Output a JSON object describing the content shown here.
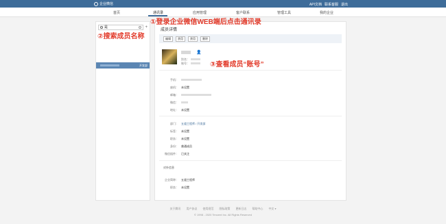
{
  "topbar": {
    "app_name": "企业微信",
    "links": [
      "API文档",
      "联系客服",
      "退出"
    ]
  },
  "nav": {
    "tabs": [
      "首页",
      "通讯录",
      "应用管理",
      "客户联系",
      "管理工具",
      "我的企业"
    ],
    "active": "通讯录"
  },
  "left": {
    "search_value": "是",
    "add_label": "+",
    "result_dept": "开发部"
  },
  "detail": {
    "title": "成员详情",
    "buttons": [
      "编辑",
      "禁用",
      "禁用",
      "删除"
    ],
    "alias_label": "别名：",
    "account_label": "账号：",
    "fields": [
      {
        "label": "手机：",
        "value": ""
      },
      {
        "label": "座机：",
        "value": "未设置"
      },
      {
        "label": "邮箱：",
        "value": ""
      },
      {
        "label": "微信：",
        "value": ""
      },
      {
        "label": "地址：",
        "value": "未设置"
      }
    ],
    "dept_label": "部门：",
    "dept_value": "五道工程师 / 开发部",
    "org_fields": [
      {
        "label": "标签：",
        "value": "未设置"
      },
      {
        "label": "职务：",
        "value": "未设置"
      },
      {
        "label": "身份：",
        "value": "普通成员"
      },
      {
        "label": "微信插件：",
        "value": "已关注"
      }
    ],
    "external_title": "对外信息",
    "external_fields": [
      {
        "label": "企业简称：",
        "value": "五道工程师"
      },
      {
        "label": "职务：",
        "value": "未设置"
      }
    ]
  },
  "footer": {
    "links": [
      "关于腾讯",
      "用户协议",
      "使用规范",
      "隐私政策",
      "更新日志",
      "帮助中心",
      "中文 ▾"
    ],
    "copyright": "© 1998 - 2020 Tencent Inc. All Rights Reserved"
  },
  "annotations": {
    "step1": "①登录企业微信WEB端后点击通讯录",
    "step2": "②搜索成员名称",
    "step3": "③查看成员“账号”"
  },
  "colors": {
    "brand": "#3e6c99",
    "annotation": "#e23b2b"
  }
}
